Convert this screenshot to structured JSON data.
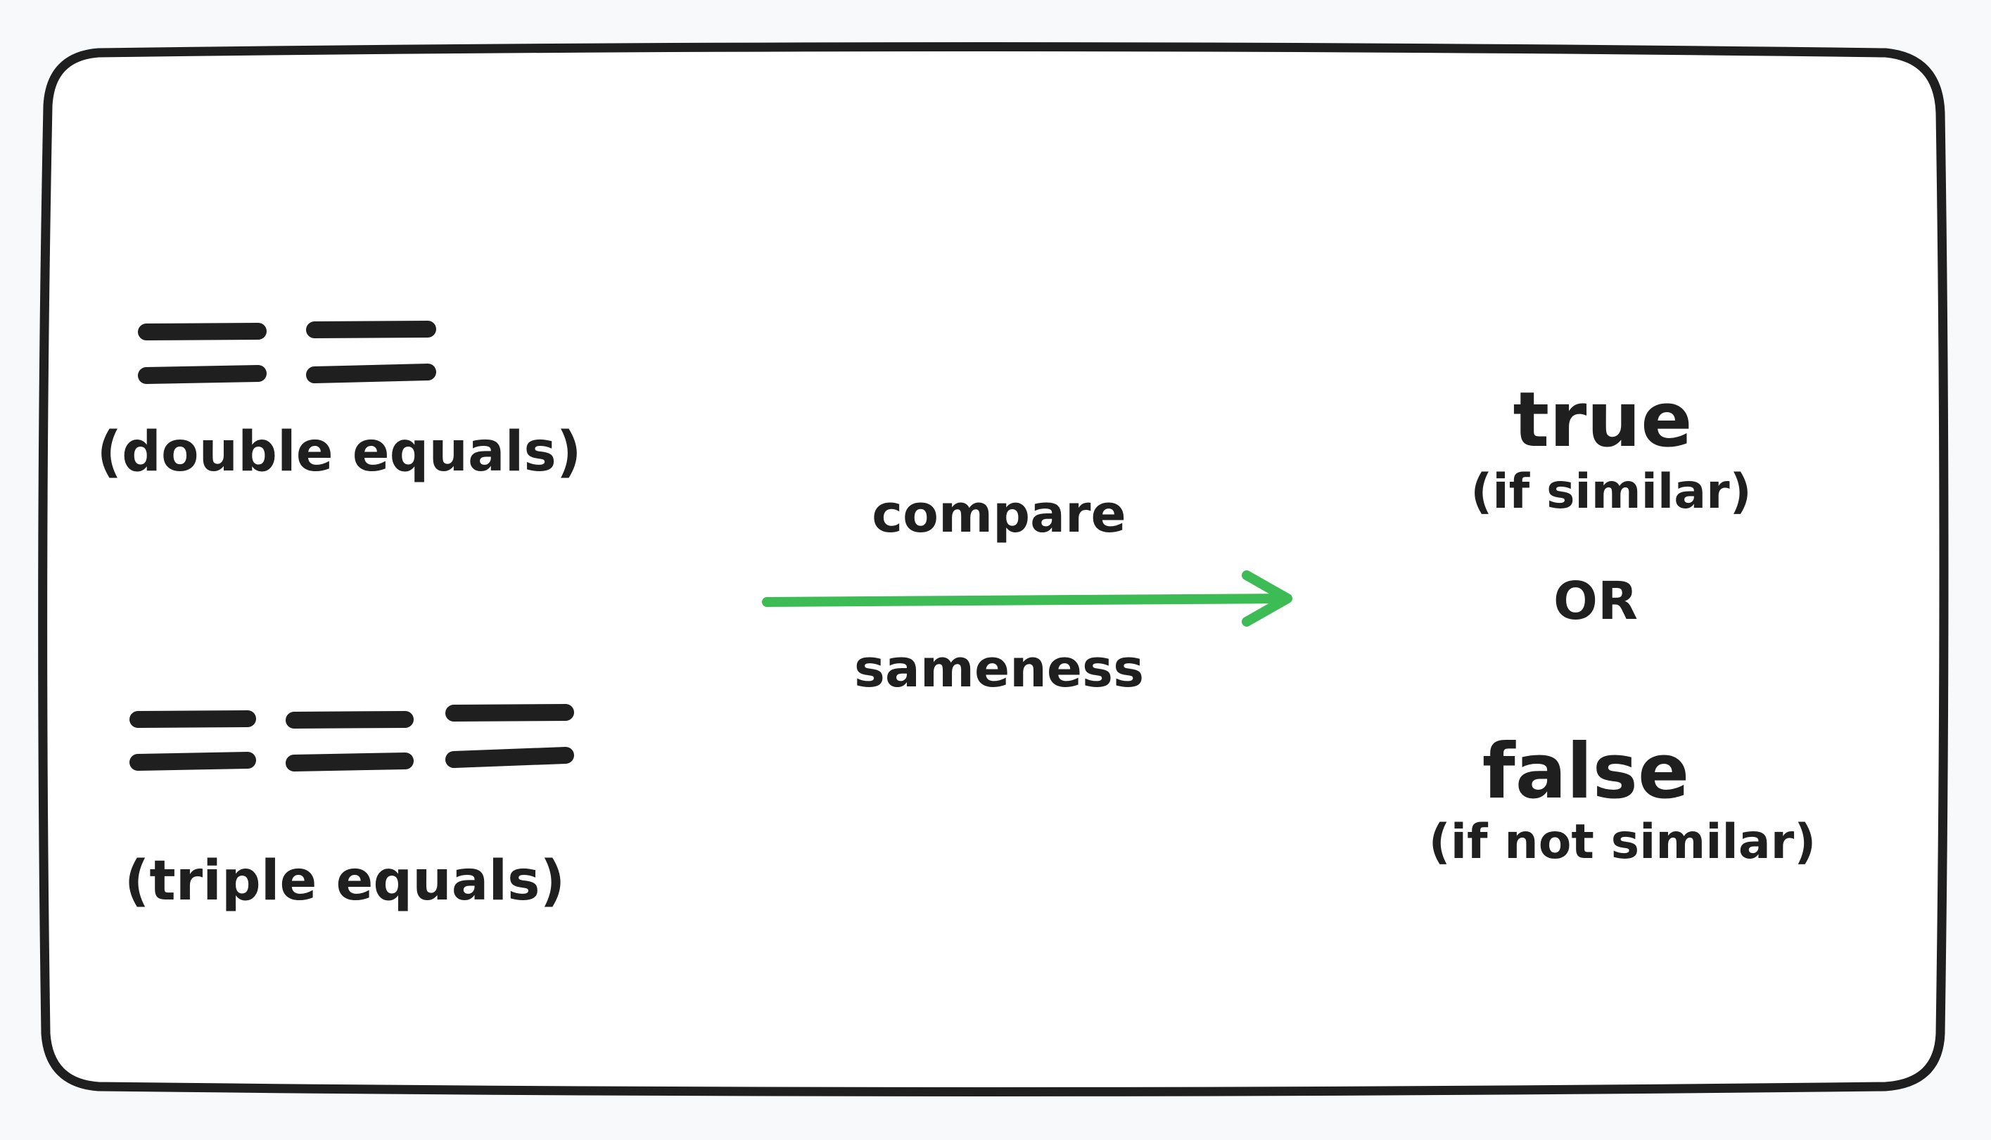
{
  "diagram": {
    "left": {
      "double_label": "(double equals)",
      "triple_label": "(triple equals)"
    },
    "middle": {
      "top_label": "compare",
      "bottom_label": "sameness"
    },
    "right": {
      "true_label": "true",
      "true_note": "(if similar)",
      "or_label": "OR",
      "false_label": "false",
      "false_note": "(if not similar)"
    },
    "colors": {
      "stroke": "#1f1f1f",
      "arrow": "#3dbb55",
      "background": "#ffffff",
      "page": "#f8f9fb"
    }
  }
}
